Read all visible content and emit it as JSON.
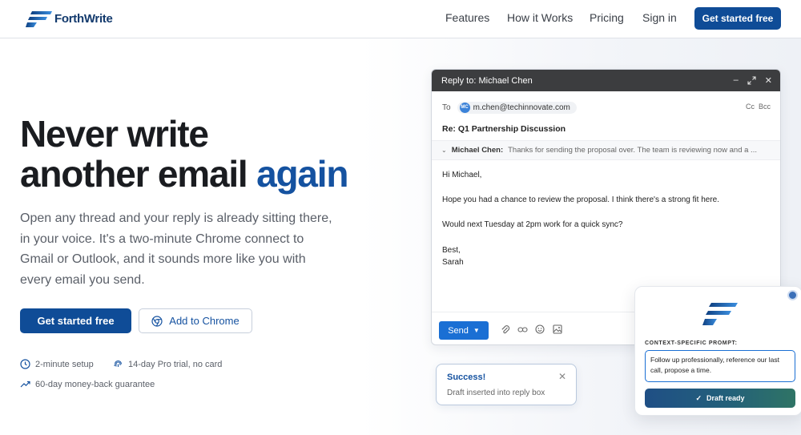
{
  "colors": {
    "brand": "#0f4c97",
    "accent": "#1552a0",
    "send": "#1a6fd4"
  },
  "nav": {
    "logo_text": "ForthWrite",
    "links": [
      "Features",
      "How it Works",
      "Pricing",
      "Sign in"
    ],
    "cta": "Get started free"
  },
  "hero": {
    "headline_line1": "Never write",
    "headline_line2": "another email",
    "headline_accent": "again",
    "subtitle": "Open any thread and your reply is already sitting there, in your voice. It's a two-minute Chrome connect to Gmail or Outlook, and it sounds more like you with every email you send.",
    "primary_button": "Get started free",
    "secondary_button": "Add to Chrome",
    "features": [
      {
        "icon": "clock-icon",
        "text": "2-minute setup"
      },
      {
        "icon": "fingerprint-icon",
        "text": "14-day Pro trial, no card"
      },
      {
        "icon": "trending-up-icon",
        "text": "60-day money-back guarantee"
      }
    ]
  },
  "email": {
    "window_title": "Reply to: Michael Chen",
    "to_label": "To",
    "recipient_initials": "MC",
    "recipient_email": "m.chen@techinnovate.com",
    "cc_bcc": "Cc  Bcc",
    "subject": "Re: Q1 Partnership Discussion",
    "thread_from": "Michael Chen:",
    "thread_preview": "Thanks for sending the proposal over. The team is reviewing now and a ...",
    "body": {
      "greeting": "Hi Michael,",
      "p1": "Hope you had a chance to review the proposal. I think there's a strong fit here.",
      "p2": "Would next Tuesday at 2pm work for a quick sync?",
      "closing": "Best,",
      "signature": "Sarah"
    },
    "send_label": "Send"
  },
  "toast": {
    "title": "Success!",
    "message": "Draft inserted into reply box"
  },
  "prompt_card": {
    "label": "CONTEXT-SPECIFIC PROMPT:",
    "text": "Follow up professionally, reference our last call, propose a time.",
    "button": "Draft ready"
  }
}
